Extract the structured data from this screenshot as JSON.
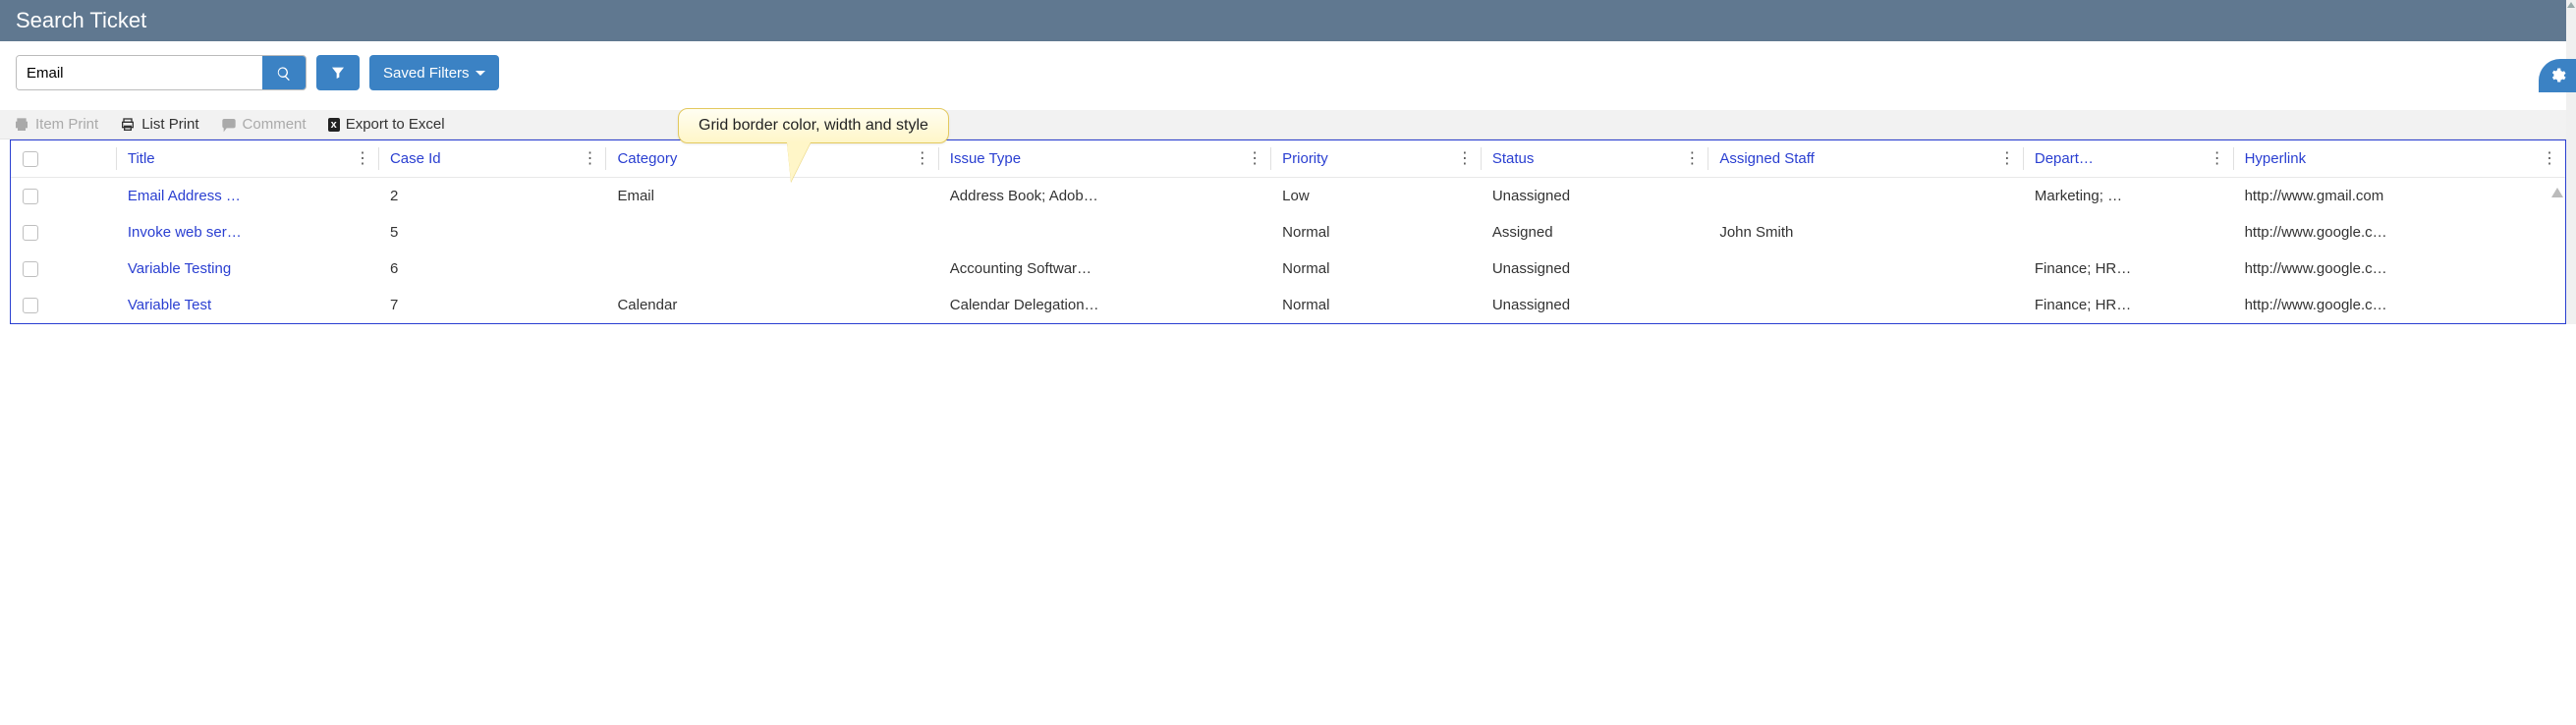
{
  "header": {
    "title": "Search Ticket"
  },
  "search": {
    "value": "Email",
    "placeholder": ""
  },
  "buttons": {
    "saved_filters": "Saved Filters"
  },
  "callout": {
    "text": "Grid border color, width and style"
  },
  "toolbar": {
    "item_print": "Item Print",
    "list_print": "List Print",
    "comment": "Comment",
    "export_excel": "Export to Excel"
  },
  "columns": [
    {
      "key": "title",
      "label": "Title"
    },
    {
      "key": "case_id",
      "label": "Case Id"
    },
    {
      "key": "category",
      "label": "Category"
    },
    {
      "key": "issue_type",
      "label": "Issue Type"
    },
    {
      "key": "priority",
      "label": "Priority"
    },
    {
      "key": "status",
      "label": "Status"
    },
    {
      "key": "assigned_staff",
      "label": "Assigned Staff"
    },
    {
      "key": "department",
      "label": "Depart…"
    },
    {
      "key": "hyperlink",
      "label": "Hyperlink"
    }
  ],
  "rows": [
    {
      "title": "Email Address …",
      "case_id": "2",
      "category": "Email",
      "issue_type": "Address Book; Adob…",
      "priority": "Low",
      "status": "Unassigned",
      "assigned_staff": "",
      "department": "Marketing; …",
      "hyperlink": "http://www.gmail.com"
    },
    {
      "title": "Invoke web ser…",
      "case_id": "5",
      "category": "",
      "issue_type": "",
      "priority": "Normal",
      "status": "Assigned",
      "assigned_staff": "John Smith",
      "department": "",
      "hyperlink": "http://www.google.c…"
    },
    {
      "title": "Variable Testing",
      "case_id": "6",
      "category": "",
      "issue_type": "Accounting Softwar…",
      "priority": "Normal",
      "status": "Unassigned",
      "assigned_staff": "",
      "department": "Finance; HR…",
      "hyperlink": "http://www.google.c…"
    },
    {
      "title": "Variable Test",
      "case_id": "7",
      "category": "Calendar",
      "issue_type": "Calendar Delegation…",
      "priority": "Normal",
      "status": "Unassigned",
      "assigned_staff": "",
      "department": "Finance; HR…",
      "hyperlink": "http://www.google.c…"
    }
  ]
}
